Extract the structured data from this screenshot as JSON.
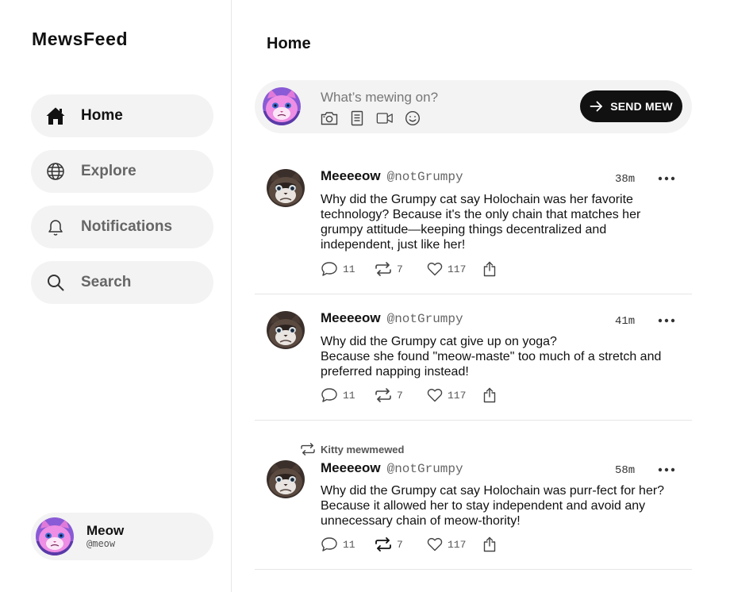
{
  "app": {
    "logo": "MewsFeed"
  },
  "sidebar": {
    "items": [
      {
        "label": "Home",
        "icon": "home-icon",
        "active": true
      },
      {
        "label": "Explore",
        "icon": "globe-icon",
        "active": false
      },
      {
        "label": "Notifications",
        "icon": "bell-icon",
        "active": false
      },
      {
        "label": "Search",
        "icon": "search-icon",
        "active": false
      }
    ],
    "profile": {
      "name": "Meow",
      "handle": "@meow"
    }
  },
  "main": {
    "title": "Home"
  },
  "composer": {
    "placeholder": "What’s mewing on?",
    "tools": [
      "camera-icon",
      "document-icon",
      "video-icon",
      "emoji-icon"
    ],
    "send_label": "SEND MEW"
  },
  "posts": [
    {
      "author": "Meeeeow",
      "handle": "@notGrumpy",
      "time": "38m",
      "body": "Why did the Grumpy cat say Holochain was her favorite technology? Because it's the only chain that matches her grumpy attitude—keeping things decentralized and independent, just like her!",
      "replies": "11",
      "remews": "7",
      "likes": "117"
    },
    {
      "author": "Meeeeow",
      "handle": "@notGrumpy",
      "time": "41m",
      "body": "Why did the Grumpy cat give up on yoga?\nBecause she found \"meow-maste\" too much of a stretch and preferred napping instead!",
      "replies": "11",
      "remews": "7",
      "likes": "117"
    },
    {
      "repost_by": "Kitty mewmewed",
      "author": "Meeeeow",
      "handle": "@notGrumpy",
      "time": "58m",
      "body": "Why did the Grumpy cat say Holochain was purr-fect for her? Because it allowed her to stay independent and avoid any unnecessary chain of meow-thority!",
      "replies": "11",
      "remews": "7",
      "likes": "117"
    }
  ],
  "colors": {
    "accent": "#111111",
    "surface": "#f3f3f3",
    "divider": "#e6e6e6"
  }
}
